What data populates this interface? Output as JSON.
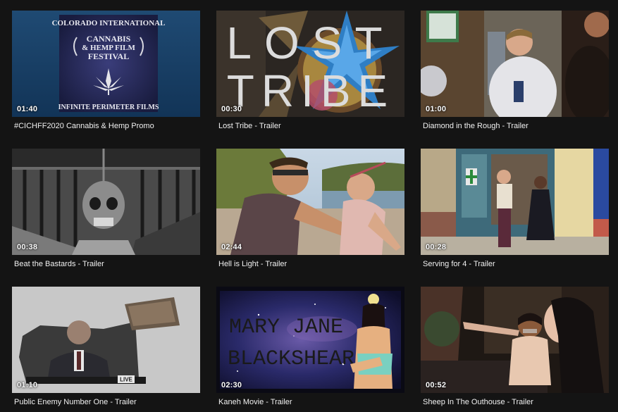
{
  "videos": [
    {
      "title": "#CICHFF2020 Cannabis & Hemp Promo",
      "duration": "01:40",
      "thumb_text": {
        "line1": "COLORADO INTERNATIONAL",
        "line2": "CANNABIS",
        "line3": "& HEMP FILM",
        "line4": "FESTIVAL",
        "footer": "INFINITE PERIMETER FILMS"
      }
    },
    {
      "title": "Lost Tribe - Trailer",
      "duration": "00:30",
      "thumb_text": {
        "top": "LOST",
        "bottom": "TRIBE"
      }
    },
    {
      "title": "Diamond in the Rough - Trailer",
      "duration": "01:00"
    },
    {
      "title": "Beat the Bastards - Trailer",
      "duration": "00:38"
    },
    {
      "title": "Hell is Light - Trailer",
      "duration": "02:44"
    },
    {
      "title": "Serving for 4 - Trailer",
      "duration": "00:28"
    },
    {
      "title": "Public Enemy Number One - Trailer",
      "duration": "01:10",
      "thumb_text": {
        "badge": "LIVE"
      }
    },
    {
      "title": "Kaneh Movie - Trailer",
      "duration": "02:30",
      "thumb_text": {
        "line1": "MARY JANE",
        "line2": "BLACKSHEAR"
      }
    },
    {
      "title": "Sheep In The Outhouse - Trailer",
      "duration": "00:52"
    }
  ],
  "colors": {
    "background": "#141414",
    "title_text": "#f1f1f1"
  }
}
